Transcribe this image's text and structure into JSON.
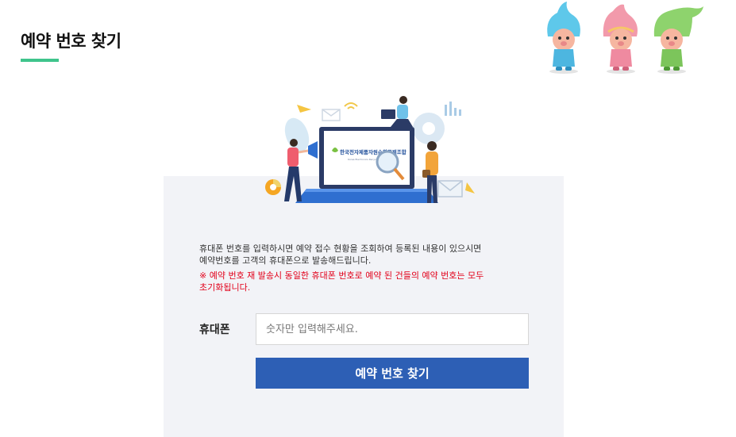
{
  "page": {
    "title": "예약 번호 찾기",
    "accent_color": "#3fc48c"
  },
  "illustration": {
    "screen_logo_text": "한국전자제품자원순환공제조합",
    "screen_logo_subtext": "Korea Electronics Recycling Cooperative",
    "icons": [
      "megaphone-icon",
      "magnifier-icon",
      "mail-icon",
      "wifi-icon",
      "paper-plane-icon",
      "bar-chart-icon",
      "pie-chart-icon",
      "gear-icon"
    ]
  },
  "mascots": [
    "blue-mascot",
    "pink-mascot",
    "green-mascot"
  ],
  "content": {
    "description_line1": "휴대폰 번호를 입력하시면 예약 접수 현황을 조회하여 등록된 내용이 있으시면",
    "description_line2": "예약번호를 고객의 휴대폰으로 발송해드립니다.",
    "notice_line1": "※ 예약 번호 재 발송시 동일한 휴대폰 번호로 예약 된 건들의 예약 번호는 모두",
    "notice_line2": "초기화됩니다.",
    "notice_color": "#e2001a"
  },
  "form": {
    "phone_label": "휴대폰",
    "phone_value": "",
    "phone_placeholder": "숫자만 입력해주세요.",
    "submit_label": "예약 번호 찾기",
    "submit_color": "#2d5fb5"
  }
}
